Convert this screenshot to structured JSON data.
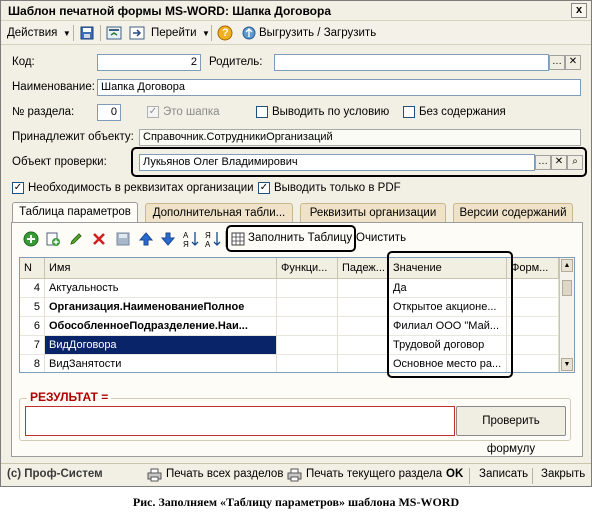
{
  "window": {
    "title": "Шаблон печатной формы MS-WORD: Шапка Договора",
    "close": "x"
  },
  "toolbar": {
    "actions": "Действия",
    "goto": "Перейти",
    "help": "?",
    "upload": "Выгрузить / Загрузить"
  },
  "form": {
    "code_label": "Код:",
    "code_value": "2",
    "parent_label": "Родитель:",
    "parent_value": "",
    "name_label": "Наименование:",
    "name_value": "Шапка Договора",
    "section_label": "№ раздела:",
    "section_value": "0",
    "is_header_label": "Это шапка",
    "conditional_label": "Выводить по условию",
    "no_content_label": "Без содержания",
    "belongs_label": "Принадлежит объекту:",
    "belongs_value": "Справочник.СотрудникиОрганизаций",
    "check_object_label": "Объект проверки:",
    "check_object_value": "Лукьянов Олег Владимирович",
    "require_label": "Необходимость в реквизитах организации",
    "pdf_only_label": "Выводить только в PDF"
  },
  "tabs": [
    {
      "label": "Таблица параметров"
    },
    {
      "label": "Дополнительная табли..."
    },
    {
      "label": "Реквизиты организации"
    },
    {
      "label": "Версии содержаний"
    }
  ],
  "table_toolbar": {
    "fill_table": "Заполнить Таблицу",
    "clear": "Очистить"
  },
  "grid": {
    "columns": [
      "N",
      "Имя",
      "Функци...",
      "Падеж...",
      "Значение",
      "Форм..."
    ],
    "rows": [
      {
        "n": "4",
        "name": "Актуальность",
        "value": "Да",
        "bold": false,
        "selected": false
      },
      {
        "n": "5",
        "name": "Организация.НаименованиеПолное",
        "value": "Открытое акционе...",
        "bold": true,
        "selected": false
      },
      {
        "n": "6",
        "name": "ОбособленноеПодразделение.Наи...",
        "value": "Филиал ООО \"Май...",
        "bold": true,
        "selected": false
      },
      {
        "n": "7",
        "name": "ВидДоговора",
        "value": "Трудовой договор",
        "bold": false,
        "selected": true
      },
      {
        "n": "8",
        "name": "ВидЗанятости",
        "value": "Основное место ра...",
        "bold": false,
        "selected": false
      }
    ]
  },
  "result": {
    "label": "РЕЗУЛЬТАТ =",
    "value": "",
    "check_button": "Проверить формулу"
  },
  "statusbar": {
    "company": "(c) Проф-Систем",
    "print_all": "Печать всех разделов",
    "print_current": "Печать текущего раздела",
    "ok": "OK",
    "save": "Записать",
    "close": "Закрыть"
  },
  "caption": "Рис. Заполняем «Таблицу параметров» шаблона MS-WORD",
  "colors": {
    "window_bg": "#f2f0e4",
    "selection": "#0a246a",
    "result_label": "#b00000",
    "highlight_outline": "#000000"
  }
}
